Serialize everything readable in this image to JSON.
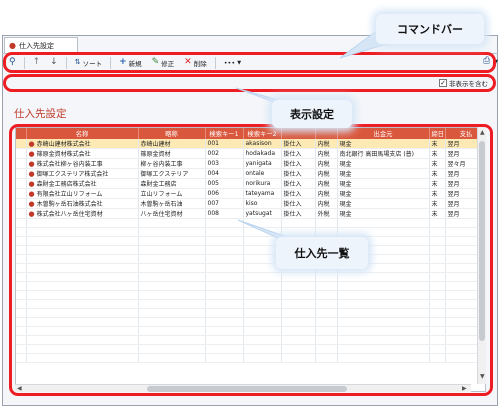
{
  "tab": {
    "title": "仕入先設定"
  },
  "toolbar": {
    "sort_label": "ソート",
    "new_label": "新規",
    "edit_label": "修正",
    "delete_label": "削除",
    "more_label": "•••"
  },
  "options": {
    "include_hidden_label": "非表示を含む",
    "include_hidden_checked": "✓"
  },
  "page_title": "仕入先設定",
  "grid": {
    "columns": [
      "名称",
      "略称",
      "検索キー1",
      "検索キー2",
      "",
      "",
      "出金元",
      "締日",
      "支払"
    ],
    "rows": [
      [
        "赤崎山建材株式会社",
        "赤崎山建材",
        "001",
        "akasison",
        "掛仕入",
        "内税",
        "現金",
        "末",
        "翌月"
      ],
      [
        "篠原金資材株式会社",
        "篠原金資材",
        "002",
        "hodakada",
        "掛仕入",
        "内税",
        "南北銀行 高田馬場支店 (普)",
        "末",
        "翌月"
      ],
      [
        "株式会社柳ヶ谷内装工事",
        "柳ヶ谷内装工事",
        "003",
        "yanigata",
        "掛仕入",
        "内税",
        "現金",
        "末",
        "翌々月"
      ],
      [
        "御塚エクステリア株式会社",
        "御塚エクステリア",
        "004",
        "ontale",
        "掛仕入",
        "内税",
        "現金",
        "末",
        "翌月"
      ],
      [
        "森財金工務店株式会社",
        "森財金工務店",
        "005",
        "norikura",
        "掛仕入",
        "内税",
        "現金",
        "末",
        "翌月"
      ],
      [
        "有限会社立山リフォーム",
        "立山リフォーム",
        "006",
        "tateyama",
        "掛仕入",
        "内税",
        "現金",
        "末",
        "翌月"
      ],
      [
        "木曽駒ヶ岳石油株式会社",
        "木曽駒ヶ岳石油",
        "007",
        "kiso",
        "掛仕入",
        "内税",
        "現金",
        "末",
        "翌月"
      ],
      [
        "株式会社八ヶ岳住宅資材",
        "八ヶ岳住宅資材",
        "008",
        "yatsugat",
        "掛仕入",
        "外税",
        "現金",
        "末",
        "翌月"
      ]
    ]
  },
  "annotations": {
    "command_bar": "コマンドバー",
    "display_settings": "表示設定",
    "supplier_list": "仕入先一覧"
  }
}
